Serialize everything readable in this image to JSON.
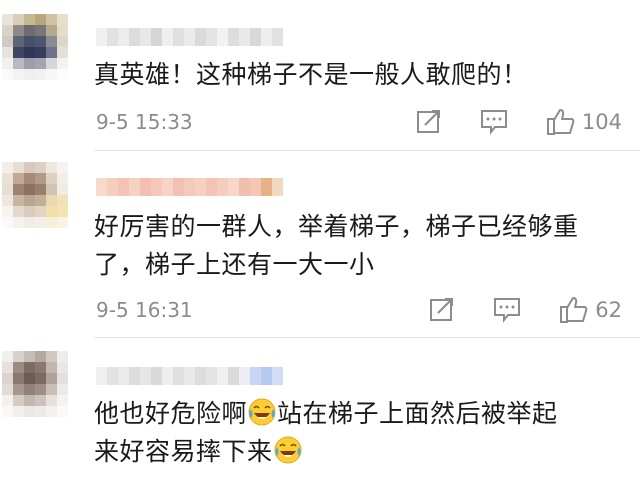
{
  "comments": [
    {
      "text_lines": [
        "真英雄！这种梯子不是一般人敢爬的！"
      ],
      "time": "9-5 15:33",
      "likes": "104",
      "avatar_colors": [
        "#e9e4d8",
        "#d9cfb6",
        "#c6b890",
        "#b6a77c",
        "#cfc3a2",
        "#e6dfcc",
        "#d8d3c7",
        "#8e8a86",
        "#6f6c6f",
        "#7a7678",
        "#b3a98d",
        "#e3dcc8",
        "#cfcac2",
        "#5f6578",
        "#46506b",
        "#4c5670",
        "#8a8b93",
        "#ddd7c9",
        "#e6e3dd",
        "#3e4663",
        "#2f3858",
        "#343d5c",
        "#6e7287",
        "#e4e0d8",
        "#f2f0ec",
        "#b8b9c2",
        "#9b9eab",
        "#a3a6b2",
        "#d6d6dc",
        "#f4f2ef",
        "#fafafa",
        "#f3f3f3",
        "#efefef",
        "#f1f1f1",
        "#f7f7f7",
        "#fcfcfc"
      ],
      "name_colors": [
        "#f0f0f0",
        "#e2e2e2",
        "#ececec",
        "#dcdcdc",
        "#e8e8e8",
        "#d6d6d6",
        "#efefef",
        "#e0e0e0",
        "#ebebeb",
        "#dadada",
        "#e4e4e4",
        "#f2f2f2",
        "#dddddd",
        "#e9e9e9",
        "#d8d8d8",
        "#eeeeee",
        "#e1e1e1"
      ]
    },
    {
      "text_lines": [
        "好厉害的一群人，举着梯子，梯子已经够重",
        "了，梯子上还有一大一小"
      ],
      "time": "9-5 16:31",
      "likes": "62",
      "avatar_colors": [
        "#f2eee9",
        "#e7ded6",
        "#d7c9bd",
        "#dccfc3",
        "#eee7df",
        "#f6f3ef",
        "#e9e1d9",
        "#bfa996",
        "#a58b76",
        "#b29a86",
        "#ddd0c4",
        "#f3eee8",
        "#e6ddd3",
        "#9e8470",
        "#8c7261",
        "#9a806c",
        "#d2c3b4",
        "#f0ebe4",
        "#efe8e0",
        "#c8b6a4",
        "#b9a590",
        "#c2ae99",
        "#e8d9b3",
        "#f0e1b8",
        "#f7f4f0",
        "#e3d8cc",
        "#d9ccbe",
        "#e1d4c3",
        "#f2dfa9",
        "#f4e3b3",
        "#fbfaf8",
        "#f5f1ec",
        "#f1ece6",
        "#f3eee7",
        "#f7efd8",
        "#faf3e0"
      ],
      "name_colors": [
        "#f9d9cc",
        "#f7cdbd",
        "#f4c3b3",
        "#f6d2c4",
        "#f3bfae",
        "#f5c9b9",
        "#f7d3c6",
        "#f2c1b1",
        "#f4cabb",
        "#f6d1c2",
        "#f3c4b4",
        "#f5cdbf",
        "#f8d6c9",
        "#f0bfae",
        "#f3c6b6",
        "#e8b384",
        "#f1d8c0"
      ]
    },
    {
      "text_lines": [
        "他也好危险啊{E}站在梯子上面然后被举起",
        "来好容易摔下来{E}"
      ],
      "avatar_colors": [
        "#f1efee",
        "#d8d2cf",
        "#c7bdb8",
        "#b6a9a3",
        "#d1c8c4",
        "#efecea",
        "#e6e1de",
        "#9c8a83",
        "#7d6a63",
        "#8b7770",
        "#c2b4ae",
        "#ebe7e5",
        "#dbd3cf",
        "#8a7770",
        "#6d5c56",
        "#7b6962",
        "#b0a19b",
        "#e5dfdc",
        "#e2dbd7",
        "#a89690",
        "#93827b",
        "#9f8d86",
        "#c9bdb8",
        "#ede9e7",
        "#f3f0ee",
        "#d5cbc7",
        "#c4b8b3",
        "#cdc2bd",
        "#e6e0dd",
        "#f5f3f2",
        "#faf9f8",
        "#f1eeec",
        "#ebe7e5",
        "#eeeae8",
        "#f4f2f1",
        "#fbfaf9"
      ],
      "name_colors": [
        "#efefef",
        "#e2e2e2",
        "#ebebeb",
        "#dcdcdc",
        "#e6e6e6",
        "#d9d9d9",
        "#eeeeee",
        "#e0e0e0",
        "#e9e9e9",
        "#dddddd",
        "#e4e4e4",
        "#f0f0f0",
        "#dadada",
        "#ecedf5",
        "#c9d5f2",
        "#b7c9f0",
        "#d2dcf5"
      ]
    }
  ]
}
